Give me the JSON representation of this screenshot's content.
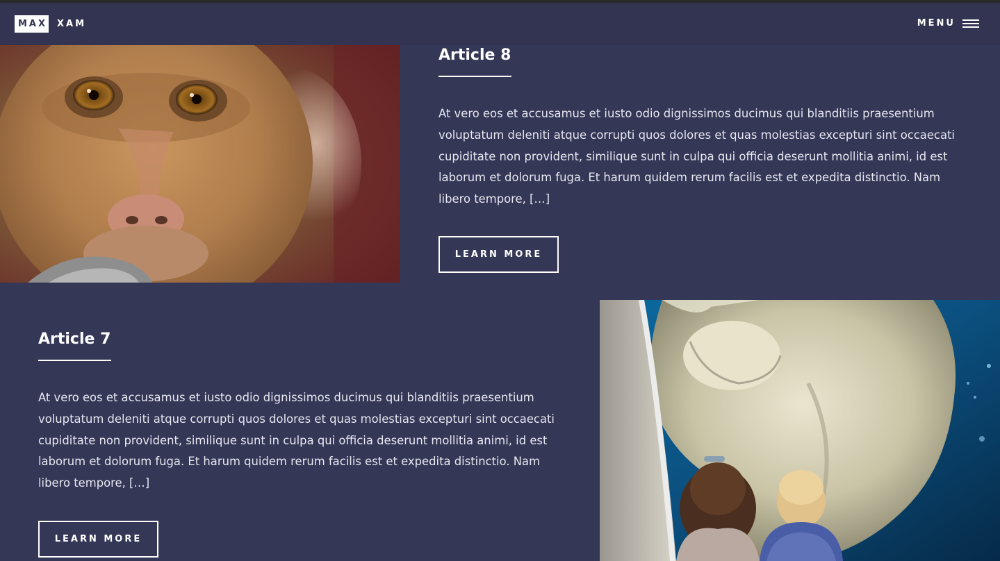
{
  "header": {
    "logo_box": "MAX",
    "logo_text": "XAM",
    "menu_label": "MENU"
  },
  "articles": [
    {
      "title": "Article 8",
      "body": "At vero eos et accusamus et iusto odio dignissimos ducimus qui blanditiis praesentium voluptatum deleniti atque corrupti quos dolores et quas molestias excepturi sint occaecati cupiditate non provident, similique sunt in culpa qui officia deserunt mollitia animi, id est laborum et dolorum fuga. Et harum quidem rerum facilis est et expedita distinctio. Nam libero tempore, […]",
      "button": "LEARN MORE",
      "image": "monkey-photo"
    },
    {
      "title": "Article 7",
      "body": "At vero eos et accusamus et iusto odio dignissimos ducimus qui blanditiis praesentium voluptatum deleniti atque corrupti quos dolores et quas molestias excepturi sint occaecati cupiditate non provident, similique sunt in culpa qui officia deserunt mollitia animi, id est laborum et dolorum fuga. Et harum quidem rerum facilis est et expedita distinctio. Nam libero tempore, […]",
      "button": "LEARN MORE",
      "image": "polar-bear-photo"
    }
  ],
  "colors": {
    "background": "#353757",
    "header": "#323452",
    "text": "#ffffff"
  }
}
